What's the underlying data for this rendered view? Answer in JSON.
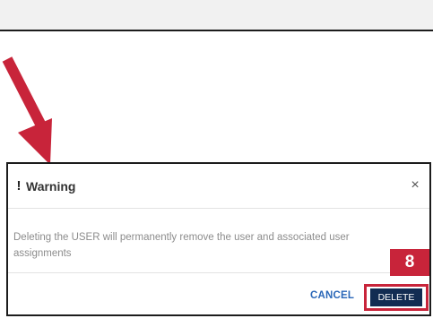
{
  "dialog": {
    "title": "Warning",
    "warning_icon": "!",
    "close_icon": "×",
    "message": "Deleting the USER will permanently remove the user and associated user assignments",
    "cancel_label": "CANCEL",
    "delete_label": "DELETE"
  },
  "annotation": {
    "step": "8",
    "color": "#c8243a"
  },
  "colors": {
    "delete_button": "#122c52",
    "cancel_text": "#2a67b8"
  },
  "icons": {
    "warning": "exclamation-icon",
    "close": "close-icon",
    "pointer": "arrow-icon"
  }
}
